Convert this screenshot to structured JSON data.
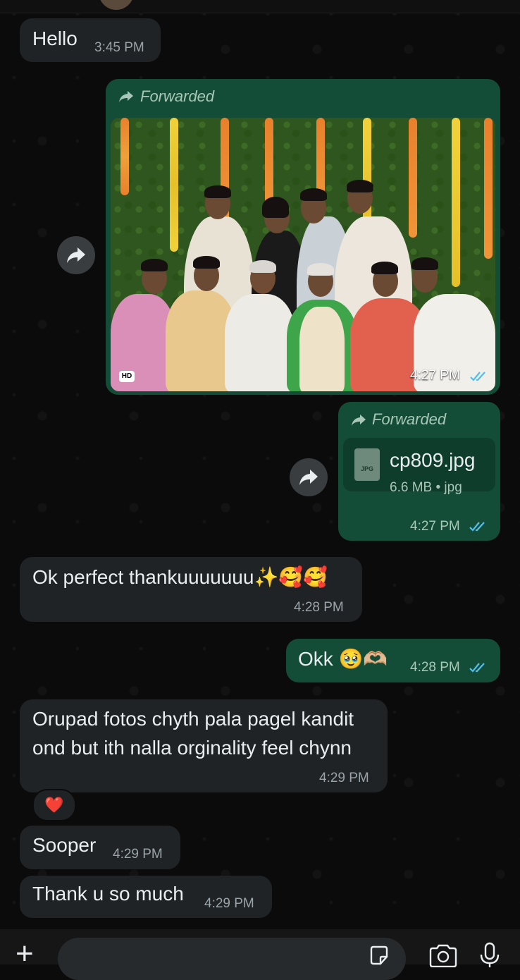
{
  "messages": [
    {
      "text": "Hello",
      "time": "3:45 PM"
    },
    {
      "forwarded_label": "Forwarded",
      "time": "4:27 PM",
      "badge": "HD"
    },
    {
      "forwarded_label": "Forwarded",
      "file_name": "cp809.jpg",
      "file_size": "6.6 MB",
      "file_type": "jpg",
      "file_icon_label": "JPG",
      "time": "4:27 PM"
    },
    {
      "text": "Ok perfect thankuuuuuuu✨🥰🥰",
      "time": "4:28 PM"
    },
    {
      "text": "Okk 🥹🫶🏼",
      "time": "4:28 PM"
    },
    {
      "text_line1": "Orupad fotos chyth pala pagel kandit",
      "text_line2": "ond but ith nalla orginality feel chynn",
      "time": "4:29 PM",
      "reaction": "❤️"
    },
    {
      "text": "Sooper",
      "time": "4:29 PM"
    },
    {
      "text": "Thank u so much",
      "time": "4:29 PM"
    }
  ],
  "colors": {
    "background": "#0b0b0b",
    "incoming_bubble": "#202326",
    "outgoing_bubble": "#144d37",
    "read_ticks": "#53bdeb"
  },
  "icons": [
    "share-icon",
    "forward-arrow-icon",
    "read-ticks-icon",
    "plus-icon",
    "sticker-icon",
    "camera-icon",
    "mic-icon"
  ]
}
